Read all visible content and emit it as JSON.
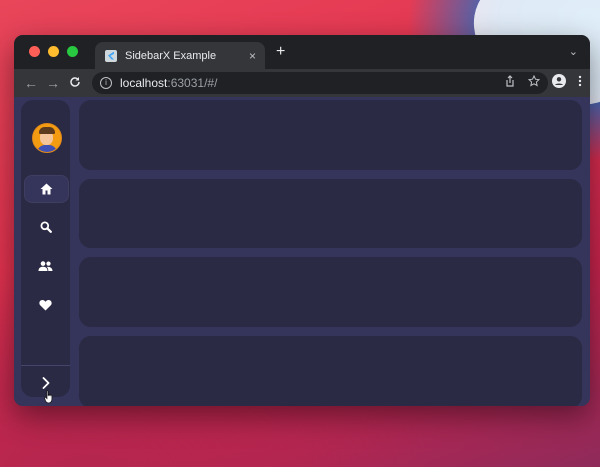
{
  "browser": {
    "tab_title": "SidebarX Example",
    "tab_close": "×",
    "new_tab": "+",
    "tab_menu": "⌄",
    "back": "←",
    "forward": "→",
    "reload": "C",
    "url_host": "localhost",
    "url_rest": ":63031/#/",
    "info": "i"
  },
  "sidebar": {
    "items": [
      {
        "icon": "home-icon",
        "selected": true
      },
      {
        "icon": "search-icon",
        "selected": false
      },
      {
        "icon": "people-icon",
        "selected": false
      },
      {
        "icon": "favorite-icon",
        "selected": false
      }
    ],
    "toggle_icon": "chevron-right-icon"
  },
  "colors": {
    "canvas": "#35345a",
    "sidebar": "#2b2a44",
    "panel": "#2b2a44",
    "selected_item": "#35345a"
  },
  "panels": 4
}
